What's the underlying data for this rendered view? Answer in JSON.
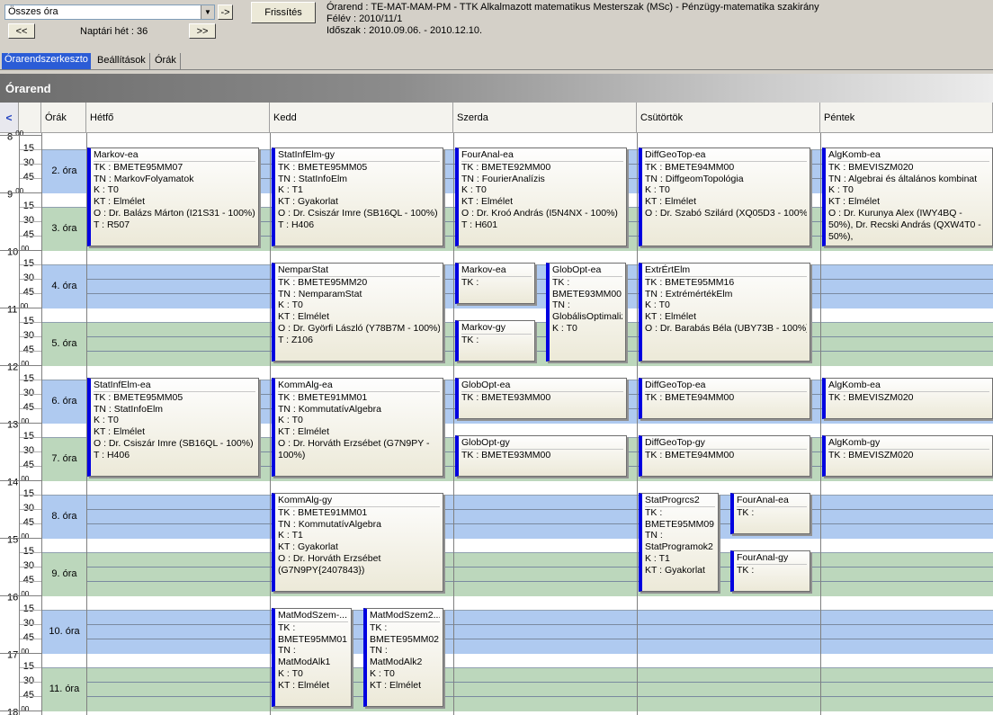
{
  "toolbar": {
    "combo": "Összes óra",
    "go": "->",
    "refresh": "Frissítés",
    "prev": "<<",
    "next": ">>",
    "week": "Naptári hét : 36"
  },
  "info": {
    "line1": "Órarend : TE-MAT-MAM-PM - TTK Alkalmazott matematikus Mesterszak (MSc) - Pénzügy-matematika szakirány",
    "line2": "Félév : 2010/11/1",
    "line3": "Időszak : 2010.09.06. - 2010.12.10."
  },
  "tabs": [
    "Órarendszerkeszto",
    "Beállítások",
    "Órák"
  ],
  "header": "Órarend",
  "columns": {
    "collapse": "<",
    "slots": "Órák",
    "days": [
      "Hétfő",
      "Kedd",
      "Szerda",
      "Csütörtök",
      "Péntek"
    ]
  },
  "hours": [
    "8",
    "9",
    "10",
    "11",
    "12",
    "13",
    "14",
    "15",
    "16",
    "17",
    "18"
  ],
  "hour_suffix": "00",
  "minutes": [
    "15",
    "30",
    "45"
  ],
  "slots": [
    "2. óra",
    "3. óra",
    "4. óra",
    "5. óra",
    "6. óra",
    "7. óra",
    "8. óra",
    "9. óra",
    "10. óra",
    "11. óra"
  ],
  "events": [
    {
      "lines": [
        "Markov-ea",
        "TK : BMETE95MM07",
        "TN : MarkovFolyamatok",
        "K : T0",
        "KT : Elmélet",
        "O : Dr. Balázs Márton (I21S31 - 100%)",
        "T : R507"
      ]
    },
    {
      "lines": [
        "StatInfElm-gy",
        "TK : BMETE95MM05",
        "TN : StatInfoElm",
        "K : T1",
        "KT : Gyakorlat",
        "O : Dr. Csiszár Imre (SB16QL - 100%)",
        "T : H406"
      ]
    },
    {
      "lines": [
        "FourAnal-ea",
        "TK : BMETE92MM00",
        "TN : FourierAnalízis",
        "K : T0",
        "KT : Elmélet",
        "O : Dr. Kroó András (I5N4NX - 100%)",
        "T : H601"
      ]
    },
    {
      "lines": [
        "DiffGeoTop-ea",
        "TK : BMETE94MM00",
        "TN : DiffgeomTopológia",
        "K : T0",
        "KT : Elmélet",
        "O : Dr. Szabó Szilárd (XQ05D3 - 100%)"
      ]
    },
    {
      "lines": [
        "AlgKomb-ea",
        "TK : BMEVISZM020",
        "TN : Algebrai és általános kombinat",
        "K : T0",
        "KT : Elmélet",
        "O : Dr. Kurunya Alex (IWY4BQ - 50%), Dr. Recski András (QXW4T0 - 50%),"
      ]
    },
    {
      "lines": [
        "NemparStat",
        "TK : BMETE95MM20",
        "TN : NemparamStat",
        "K : T0",
        "KT : Elmélet",
        "O : Dr. Györfi László (Y78B7M - 100%)",
        "T : Z106"
      ]
    },
    {
      "lines": [
        "Markov-ea",
        "TK :"
      ]
    },
    {
      "lines": [
        "GlobOpt-ea",
        "TK : BMETE93MM00",
        "TN : GlobálisOptimalizálás",
        "K : T0"
      ]
    },
    {
      "lines": [
        "ExtrÉrtElm",
        "TK : BMETE95MM16",
        "TN : ExtrémértékElm",
        "K : T0",
        "KT : Elmélet",
        "O : Dr. Barabás Béla (UBY73B - 100%)"
      ]
    },
    {
      "lines": [
        "Markov-gy",
        "TK :"
      ]
    },
    {
      "lines": [
        "StatInfElm-ea",
        "TK : BMETE95MM05",
        "TN : StatInfoElm",
        "K : T0",
        "KT : Elmélet",
        "O : Dr. Csiszár Imre (SB16QL - 100%)",
        "T : H406"
      ]
    },
    {
      "lines": [
        "KommAlg-ea",
        "TK : BMETE91MM01",
        "TN : KommutatívAlgebra",
        "K : T0",
        "KT : Elmélet",
        "O : Dr. Horváth Erzsébet (G7N9PY - 100%)"
      ]
    },
    {
      "lines": [
        "GlobOpt-ea",
        "TK : BMETE93MM00"
      ]
    },
    {
      "lines": [
        "DiffGeoTop-ea",
        "TK : BMETE94MM00"
      ]
    },
    {
      "lines": [
        "AlgKomb-ea",
        "TK : BMEVISZM020"
      ]
    },
    {
      "lines": [
        "GlobOpt-gy",
        "TK : BMETE93MM00"
      ]
    },
    {
      "lines": [
        "DiffGeoTop-gy",
        "TK : BMETE94MM00"
      ]
    },
    {
      "lines": [
        "AlgKomb-gy",
        "TK : BMEVISZM020"
      ]
    },
    {
      "lines": [
        "KommAlg-gy",
        "TK : BMETE91MM01",
        "TN : KommutatívAlgebra",
        "K : T1",
        "KT : Gyakorlat",
        "O : Dr. Horváth Erzsébet (G7N9PY{2407843})"
      ]
    },
    {
      "lines": [
        "StatProgrcs2",
        "TK : BMETE95MM09",
        "TN : StatProgramok2",
        "K : T1",
        "KT : Gyakorlat"
      ]
    },
    {
      "lines": [
        "FourAnal-ea",
        "TK :"
      ]
    },
    {
      "lines": [
        "FourAnal-gy",
        "TK :"
      ]
    },
    {
      "lines": [
        "MatModSzem-...",
        "TK : BMETE95MM01",
        "TN : MatModAlk1",
        "K : T0",
        "KT : Elmélet"
      ]
    },
    {
      "lines": [
        "MatModSzem2...",
        "TK : BMETE95MM02",
        "TN : MatModAlk2",
        "K : T0",
        "KT : Elmélet"
      ]
    }
  ]
}
